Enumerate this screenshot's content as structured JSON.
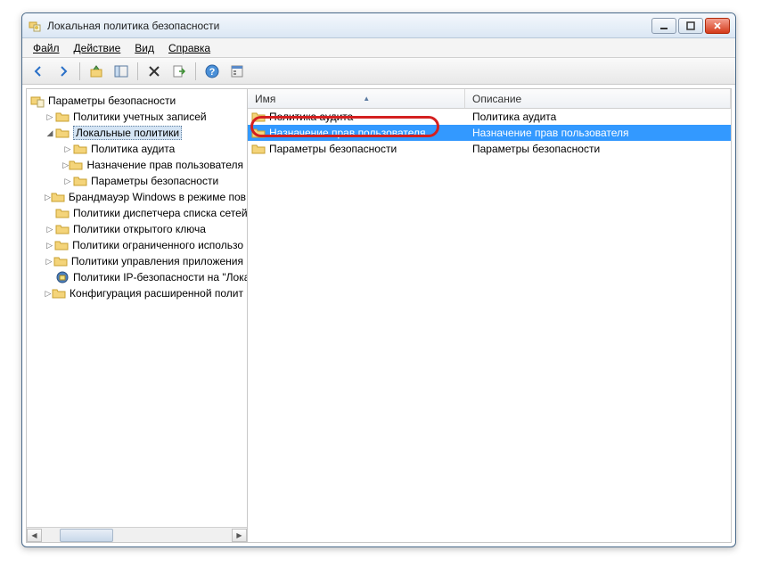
{
  "window": {
    "title": "Локальная политика безопасности"
  },
  "menu": {
    "file": "Файл",
    "action": "Действие",
    "view": "Вид",
    "help": "Справка"
  },
  "tree": {
    "root": "Параметры безопасности",
    "accountPolicies": "Политики учетных записей",
    "localPolicies": "Локальные политики",
    "auditPolicy": "Политика аудита",
    "userRights": "Назначение прав пользователя",
    "secOptions": "Параметры безопасности",
    "firewall": "Брандмауэр Windows в режиме пов",
    "netListMgr": "Политики диспетчера списка сетей",
    "publicKey": "Политики открытого ключа",
    "softRestrict": "Политики ограниченного использо",
    "appControl": "Политики управления приложения",
    "ipsec": "Политики IP-безопасности на \"Лока",
    "advAudit": "Конфигурация расширенной полит"
  },
  "list": {
    "header": {
      "name": "Имя",
      "desc": "Описание"
    },
    "rows": [
      {
        "name": "Политика аудита",
        "desc": "Политика аудита"
      },
      {
        "name": "Назначение прав пользователя",
        "desc": "Назначение прав пользователя"
      },
      {
        "name": "Параметры безопасности",
        "desc": "Параметры безопасности"
      }
    ]
  }
}
